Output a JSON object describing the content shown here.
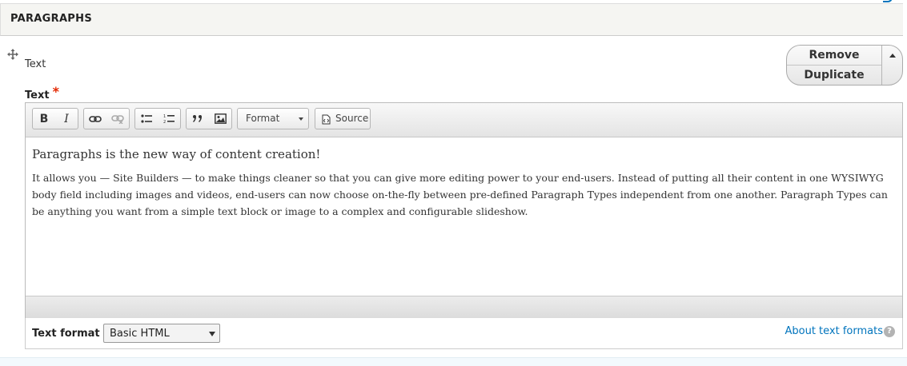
{
  "panel": {
    "title": "PARAGRAPHS"
  },
  "paragraph": {
    "type_label": "Text"
  },
  "actions": {
    "remove_label": "Remove",
    "duplicate_label": "Duplicate"
  },
  "field": {
    "label": "Text",
    "required_marker": "*"
  },
  "toolbar": {
    "bold_label": "B",
    "italic_label": "I",
    "format_label": "Format",
    "source_label": "Source",
    "icons": [
      "link-icon",
      "unlink-icon",
      "bulleted-list-icon",
      "numbered-list-icon",
      "blockquote-icon",
      "image-icon",
      "source-icon"
    ]
  },
  "content": {
    "heading": "Paragraphs is the new way of content creation!",
    "body": "It allows you — Site Builders — to make things cleaner so that you can give more editing power to your end-users. Instead of putting all their content in one WYSIWYG body field including images and videos, end-users can now choose on-the-fly between pre-defined Paragraph Types independent from one another. Paragraph Types can be anything you want from a simple text block or image to a complex and configurable slideshow."
  },
  "text_format": {
    "label": "Text format",
    "selected": "Basic HTML",
    "about_link": "About text formats",
    "help_glyph": "?"
  },
  "colors": {
    "link": "#0074bd",
    "required": "#e32700"
  }
}
